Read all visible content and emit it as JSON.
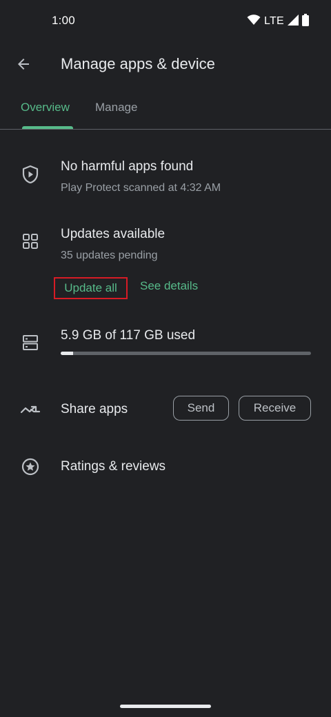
{
  "status_bar": {
    "time": "1:00",
    "network": "LTE",
    "icons": [
      "wifi-icon",
      "cell-signal-icon",
      "battery-icon"
    ]
  },
  "app_bar": {
    "back_icon": "arrow-back-icon",
    "title": "Manage apps & device"
  },
  "tabs": [
    {
      "label": "Overview",
      "selected": true
    },
    {
      "label": "Manage",
      "selected": false
    }
  ],
  "protect": {
    "icon": "shield-play-icon",
    "title": "No harmful apps found",
    "subtitle": "Play Protect scanned at 4:32 AM"
  },
  "updates": {
    "icon": "apps-grid-icon",
    "title": "Updates available",
    "subtitle": "35 updates pending",
    "update_all_label": "Update all",
    "see_details_label": "See details"
  },
  "storage": {
    "icon": "storage-icon",
    "label": "5.9 GB of 117 GB used",
    "used_fraction": 0.05
  },
  "share": {
    "icon": "share-apps-icon",
    "title": "Share apps",
    "send_label": "Send",
    "receive_label": "Receive"
  },
  "ratings": {
    "icon": "star-circle-icon",
    "title": "Ratings & reviews"
  },
  "colors": {
    "background": "#202124",
    "accent": "#57bb8a",
    "highlight_box": "#d81b25",
    "text_primary": "#e8eaed",
    "text_secondary": "#9aa0a6"
  }
}
